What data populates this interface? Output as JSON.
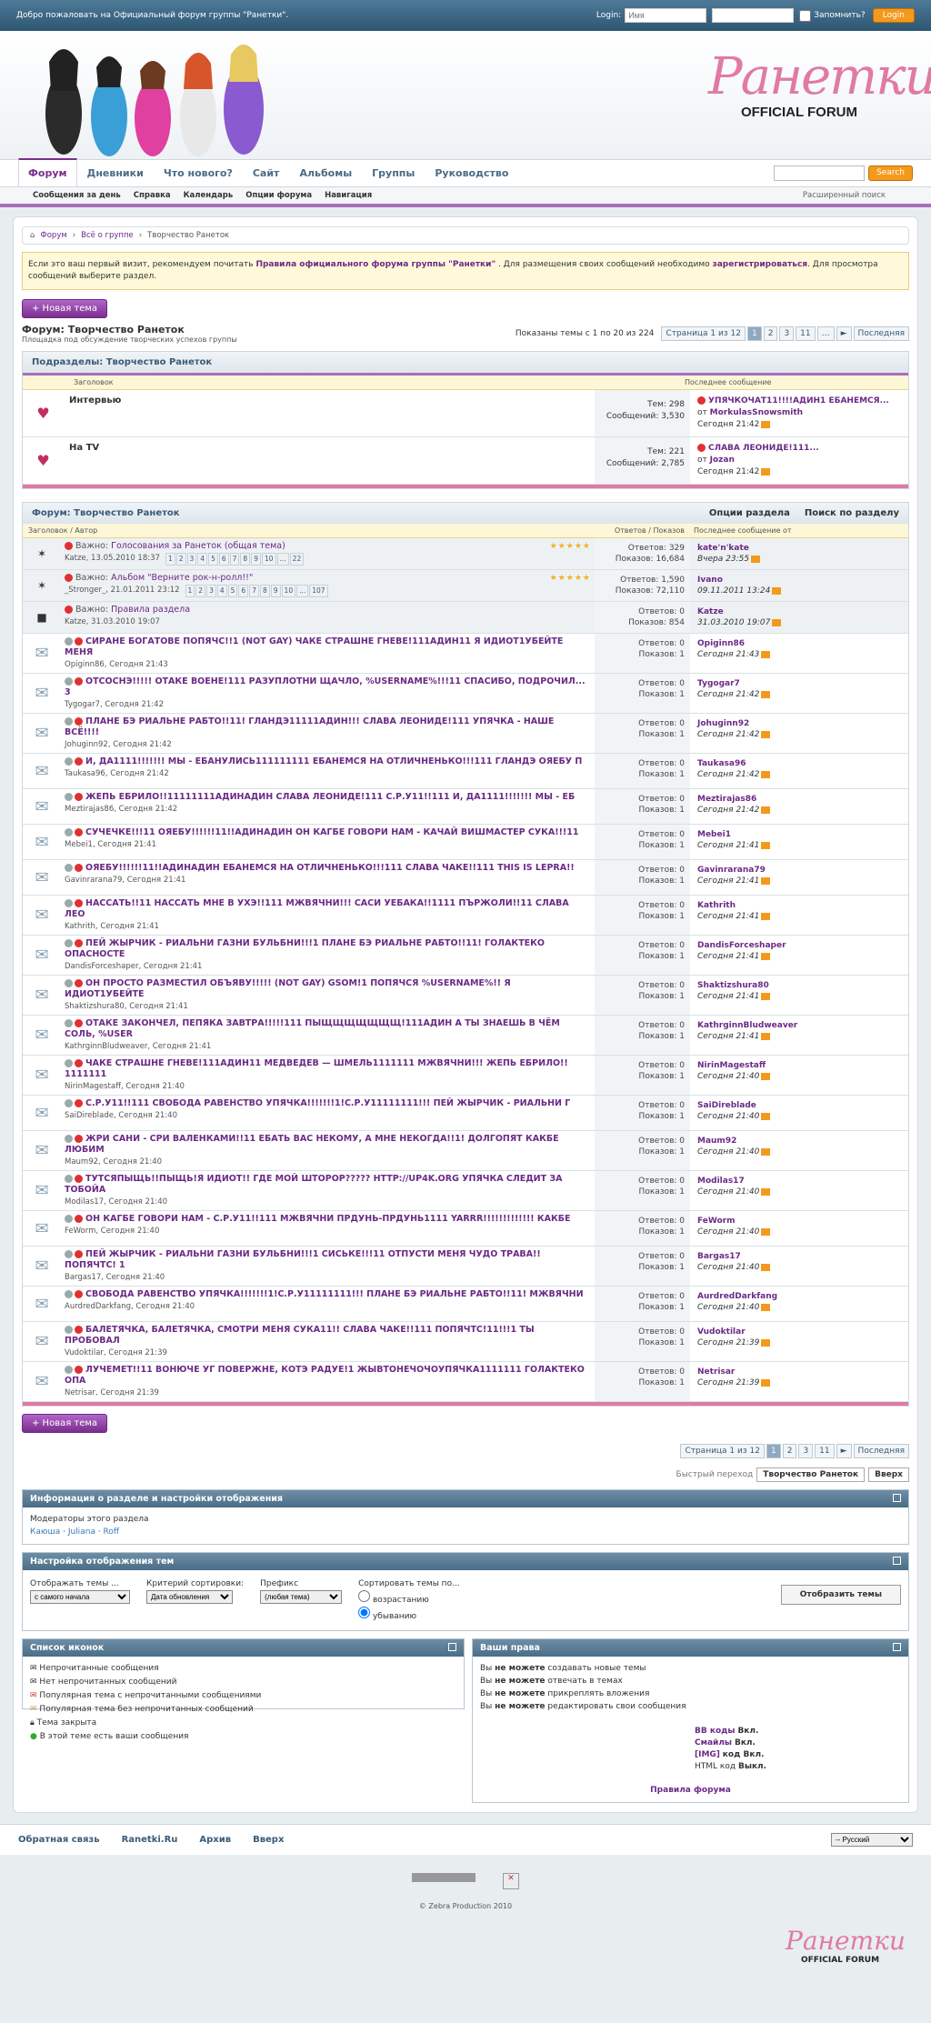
{
  "topbar": {
    "welcome": "Добро пожаловать на Официальный форум группы \"Ранетки\".",
    "login_label": "Login:",
    "user_placeholder": "Имя",
    "remember": "Запомнить?",
    "login_button": "Login"
  },
  "header": {
    "logo_script": "Ранетки",
    "logo_sub": "OFFICIAL FORUM"
  },
  "nav": {
    "tabs": [
      "Форум",
      "Дневники",
      "Что нового?",
      "Сайт",
      "Альбомы",
      "Группы",
      "Руководство"
    ],
    "search_button": "Search"
  },
  "subnav": {
    "items": [
      "Сообщения за день",
      "Справка",
      "Календарь",
      "Опции форума",
      "Навигация"
    ],
    "right": "Расширенный поиск"
  },
  "breadcrumb": [
    "Форум",
    "Всё о группе",
    "Творчество Ранеток"
  ],
  "notice": {
    "p1": "Если это ваш первый визит, рекомендуем почитать ",
    "link1": "Правила официального форума группы \"Ранетки\"",
    "p2": " . Для размещения своих сообщений необходимо ",
    "link2": "зарегистрироваться",
    "p3": ". Для просмотра сообщений выберите раздел."
  },
  "new_thread": "+ Новая тема",
  "forum": {
    "title": "Форум: Творчество Ранеток",
    "desc": "Площадка под обсуждение творческих успехов группы",
    "shown": "Показаны темы с 1 по 20 из 224"
  },
  "pagination": {
    "label": "Страница 1 из 12",
    "pages": [
      "1",
      "2",
      "3",
      "11"
    ],
    "next": "►",
    "last": "Последняя"
  },
  "subforums": {
    "title": "Подразделы: Творчество Ранеток",
    "col1": "Заголовок",
    "col2": "Последнее сообщение",
    "items": [
      {
        "name": "Интервью",
        "topics": "Тем: 298",
        "posts": "Сообщений: 3,530",
        "last_title": "УПЯЧКОЧАТ11!!!!АДИН1 ЕБАНЕМСЯ...",
        "last_by": "от",
        "last_user": "MorkulasSnowsmith",
        "last_time": "Сегодня 21:42"
      },
      {
        "name": "На TV",
        "topics": "Тем: 221",
        "posts": "Сообщений: 2,785",
        "last_title": "СЛАВА ЛЕОНИДЕ!111...",
        "last_by": "от",
        "last_user": "Jozan",
        "last_time": "Сегодня 21:42"
      }
    ]
  },
  "threads": {
    "title": "Форум: Творчество Ранеток",
    "opt1": "Опции раздела",
    "opt2": "Поиск по разделу",
    "col1": "Заголовок / Автор",
    "col2": "Ответов / Показов",
    "col3": "Последнее сообщение от",
    "sticky": [
      {
        "prefix": "Важно: ",
        "title": "Голосования за Ранеток (общая тема)",
        "meta": "Katze, 13.05.2010 18:37",
        "pages": [
          "1",
          "2",
          "3",
          "4",
          "5",
          "6",
          "7",
          "8",
          "9",
          "10",
          "...",
          "22"
        ],
        "replies": "Ответов: 329",
        "views": "Показов: 16,684",
        "user": "kate'n'kate",
        "time": "Вчера 23:55"
      },
      {
        "prefix": "Важно: ",
        "title": "Альбом \"Верните рок-н-ролл!!\"",
        "meta": "_Stronger_, 21.01.2011 23:12",
        "pages": [
          "1",
          "2",
          "3",
          "4",
          "5",
          "6",
          "7",
          "8",
          "9",
          "10",
          "...",
          "107"
        ],
        "replies": "Ответов: 1,590",
        "views": "Показов: 72,110",
        "user": "Ivano",
        "time": "09.11.2011 13:24"
      },
      {
        "prefix": "Важно: ",
        "title": "Правила раздела",
        "meta": "Katze, 31.03.2010 19:07",
        "pages": [],
        "replies": "Ответов: 0",
        "views": "Показов: 854",
        "user": "Katze",
        "time": "31.03.2010 19:07"
      }
    ],
    "items": [
      {
        "title": "СИРАНЕ БОГАТОВЕ ПОПЯЧС!!1 (NOT GAY) ЧАКЕ СТРАШНЕ ГНЕВЕ!111АДИН11 Я ИДИОТ1УБЕЙТЕ МЕНЯ",
        "meta": "Opiginn86, Сегодня 21:43",
        "user": "Opiginn86",
        "time": "Сегодня 21:43"
      },
      {
        "title": "ОТСОСНЭ!!!!! ОТАКЕ ВОЕНЕ!111 РАЗУПЛОТНИ ЩАЧЛО, %USERNAME%!!!11 СПАСИБО, ПОДРОЧИЛ... 3",
        "meta": "Tygogar7, Сегодня 21:42",
        "user": "Tygogar7",
        "time": "Сегодня 21:42"
      },
      {
        "title": "ПЛАНЕ БЭ РИАЛЬНЕ РАБТО!!11! ГЛАНДЭ11111АДИН!!! СЛАВА ЛЕОНИДЕ!111 УПЯЧКА - НАШЕ ВСЁ!!!!",
        "meta": "Johuginn92, Сегодня 21:42",
        "user": "Johuginn92",
        "time": "Сегодня 21:42"
      },
      {
        "title": "И, ДА1111!!!!!!! МЫ - ЕБАНУЛИСЬ111111111 ЕБАНЕМСЯ НА ОТЛИЧНЕНЬКО!!!111 ГЛАНДЭ ОЯЕБУ П",
        "meta": "Taukasa96, Сегодня 21:42",
        "user": "Taukasa96",
        "time": "Сегодня 21:42"
      },
      {
        "title": "ЖЕПЬ ЕБРИЛО!!11111111АДИНАДИН СЛАВА ЛЕОНИДЕ!111 С.Р.У11!!111 И, ДА1111!!!!!!! МЫ - ЕБ",
        "meta": "Meztirajas86, Сегодня 21:42",
        "user": "Meztirajas86",
        "time": "Сегодня 21:42"
      },
      {
        "title": "СУЧЕЧКЕ!!!11 ОЯЕБУ!!!!!!11!!АДИНАДИН ОН КАГБЕ ГОВОРИ НАМ - КАЧАЙ ВИШМАСТЕР СУКА!!!11",
        "meta": "Mebei1, Сегодня 21:41",
        "user": "Mebei1",
        "time": "Сегодня 21:41"
      },
      {
        "title": "ОЯЕБУ!!!!!!11!!АДИНАДИН ЕБАНЕМСЯ НА ОТЛИЧНЕНЬКО!!!111 СЛАВА ЧАКЕ!!111 THIS IS LEPRA!!",
        "meta": "Gavinrarana79, Сегодня 21:41",
        "user": "Gavinrarana79",
        "time": "Сегодня 21:41"
      },
      {
        "title": "НАССАТЬ!!11 НАССАТЬ МНЕ В УХЭ!!111 МЖВЯЧНИ!!! САСИ УЕБАКА!!1111 ПЪРЖОЛИ!!11 СЛАВА ЛЕО",
        "meta": "Kathrith, Сегодня 21:41",
        "user": "Kathrith",
        "time": "Сегодня 21:41"
      },
      {
        "title": "ПЕЙ ЖЫРЧИК - РИАЛЬНИ ГАЗНИ БУЛЬБНИ!!!1 ПЛАНЕ БЭ РИАЛЬНЕ РАБТО!!11! ГОЛАКТЕКО ОПАСНОСТЕ",
        "meta": "DandisForceshaper, Сегодня 21:41",
        "user": "DandisForceshaper",
        "time": "Сегодня 21:41"
      },
      {
        "title": "ОН ПРОСТО РАЗМЕСТИЛ ОБЪЯВУ!!!!! (NOT GAY) GSOM!1 ПОПЯЧСЯ %USERNAME%!! Я ИДИОТ1УБЕЙТЕ",
        "meta": "Shaktizshura80, Сегодня 21:41",
        "user": "Shaktizshura80",
        "time": "Сегодня 21:41"
      },
      {
        "title": "ОТАКЕ ЗАКОНЧЕЛ, ПЕПЯКА ЗАВТРА!!!!!111 ПЫЩЩЩЩЩЩЩ!111АДИН А ТЫ ЗНАЕШЬ В ЧЁМ СОЛЬ, %USER",
        "meta": "KathrginnBludweaver, Сегодня 21:41",
        "user": "KathrginnBludweaver",
        "time": "Сегодня 21:41"
      },
      {
        "title": "ЧАКЕ СТРАШНЕ ГНЕВЕ!111АДИН11 МЕДВЕДЕВ — ШМЕЛЬ1111111 МЖВЯЧНИ!!! ЖЕПЬ ЕБРИЛО!! 1111111",
        "meta": "NirinMagestaff, Сегодня 21:40",
        "user": "NirinMagestaff",
        "time": "Сегодня 21:40"
      },
      {
        "title": "С.Р.У11!!111 СВОБОДА РАВЕНСТВО УПЯЧКА!!!!!!!1!С.Р.У11111111!!! ПЕЙ ЖЫРЧИК - РИАЛЬНИ Г",
        "meta": "SaiDireblade, Сегодня 21:40",
        "user": "SaiDireblade",
        "time": "Сегодня 21:40"
      },
      {
        "title": "ЖРИ САНИ - СРИ ВАЛЕНКАМИ!!11 ЕБАТЬ ВАС НЕКОМУ, А МНЕ НЕКОГДА!!1! ДОЛГОПЯТ КАКБЕ ЛЮБИМ",
        "meta": "Maum92, Сегодня 21:40",
        "user": "Maum92",
        "time": "Сегодня 21:40"
      },
      {
        "title": "ТУТСЯПЫЩЬ!!ПЫЩЬ!Я ИДИОТ!! ГДЕ МОЙ ШТОРОР????? HTTP://UP4K.ORG УПЯЧКА СЛЕДИТ ЗА ТОБОЙА",
        "meta": "Modilas17, Сегодня 21:40",
        "user": "Modilas17",
        "time": "Сегодня 21:40"
      },
      {
        "title": "ОН КАГБЕ ГОВОРИ НАМ - С.Р.У11!!111 МЖВЯЧНИ ПРДУНЬ-ПРДУНЬ1111 YARRR!!!!!!!!!!!!! КАКБЕ",
        "meta": "FeWorm, Сегодня 21:40",
        "user": "FeWorm",
        "time": "Сегодня 21:40"
      },
      {
        "title": "ПЕЙ ЖЫРЧИК - РИАЛЬНИ ГАЗНИ БУЛЬБНИ!!!1 СИСЬКЕ!!!11 ОТПУСТИ МЕНЯ ЧУДО ТРАВА!! ПОПЯЧТС! 1",
        "meta": "Bargas17, Сегодня 21:40",
        "user": "Bargas17",
        "time": "Сегодня 21:40"
      },
      {
        "title": "СВОБОДА РАВЕНСТВО УПЯЧКА!!!!!!!1!С.Р.У11111111!!! ПЛАНЕ БЭ РИАЛЬНЕ РАБТО!!11! МЖВЯЧНИ",
        "meta": "AurdredDarkfang, Сегодня 21:40",
        "user": "AurdredDarkfang",
        "time": "Сегодня 21:40"
      },
      {
        "title": "БАЛЕТЯЧКА, БАЛЕТЯЧКА, СМОТРИ МЕНЯ СУКА11!! СЛАВА ЧАКЕ!!111 ПОПЯЧТС!11!!!1 ТЫ ПРОБОВАЛ",
        "meta": "Vudoktilar, Сегодня 21:39",
        "user": "Vudoktilar",
        "time": "Сегодня 21:39"
      },
      {
        "title": "ЛУЧЕМЕТ!!11 ВОНЮЧЕ УГ ПОВЕРЖНЕ, КОТЭ РАДУЕ!1 ЖЫВТОНЕЧОЧОУПЯЧКА1111111 ГОЛАКТЕКО ОПА",
        "meta": "Netrisar, Сегодня 21:39",
        "user": "Netrisar",
        "time": "Сегодня 21:39"
      }
    ],
    "replies": "Ответов: 0",
    "views": "Показов: 1"
  },
  "quick": {
    "label": "Быстрый переход",
    "select": "Творчество Ранеток",
    "up": "Вверх"
  },
  "info": {
    "title": "Информация о разделе и настройки отображения",
    "mods_label": "Модераторы этого раздела",
    "mods": [
      "Каюша",
      "Juliana",
      "Roff"
    ]
  },
  "display": {
    "title": "Настройка отображения тем",
    "f1_label": "Отображать темы ...",
    "f1_val": "с самого начала",
    "f2_label": "Критерий сортировки:",
    "f2_val": "Дата обновления",
    "f3_label": "Префикс",
    "f3_val": "(любая тема)",
    "f4_label": "Сортировать темы по...",
    "f4_opt1": "возрастанию",
    "f4_opt2": "убыванию",
    "button": "Отобразить темы"
  },
  "icons": {
    "title": "Список иконок",
    "items": [
      "Непрочитанные сообщения",
      "Нет непрочитанных сообщений",
      "Популярная тема с непрочитанными сообщениями",
      "Популярная тема без непрочитанных сообщений",
      "Тема закрыта",
      "В этой теме есть ваши сообщения"
    ]
  },
  "rights": {
    "title": "Ваши права",
    "items": [
      {
        "pre": "Вы ",
        "bold": "не можете",
        "post": " создавать новые темы"
      },
      {
        "pre": "Вы ",
        "bold": "не можете",
        "post": " отвечать в темах"
      },
      {
        "pre": "Вы ",
        "bold": "не можете",
        "post": " прикреплять вложения"
      },
      {
        "pre": "Вы ",
        "bold": "не можете",
        "post": " редактировать свои сообщения"
      }
    ],
    "codes": [
      {
        "k": "BB коды",
        "v": "Вкл."
      },
      {
        "k": "Смайлы",
        "v": "Вкл."
      },
      {
        "k": "[IMG]",
        "v": "код Вкл."
      },
      {
        "k": "HTML код",
        "v": "Выкл."
      }
    ],
    "rules": "Правила форума"
  },
  "footer": {
    "links": [
      "Обратная связь",
      "Ranetki.Ru",
      "Архив",
      "Вверх"
    ],
    "lang": "-- Русский",
    "copy": "© Zebra Production 2010"
  }
}
